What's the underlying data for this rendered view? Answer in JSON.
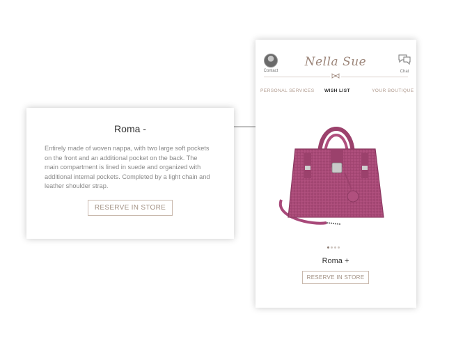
{
  "detail_card": {
    "title": "Roma -",
    "description": "Entirely made of woven nappa, with two large soft pockets on the front and an additional pocket on the back. The main compartment is lined in suede and organized with additional internal pockets. Completed by a light chain and leather shoulder strap.",
    "reserve_label": "RESERVE IN STORE"
  },
  "phone": {
    "brand": "Nella Sue",
    "contact_label": "Contact",
    "chat_label": "Chat",
    "tabs": [
      {
        "label": "PERSONAL SERVICES",
        "active": false
      },
      {
        "label": "WISH LIST",
        "active": true
      },
      {
        "label": "YOUR BOUTIQUE",
        "active": false
      }
    ],
    "carousel": {
      "pages": 4,
      "current": 1
    },
    "product_title": "Roma +",
    "reserve_label": "RESERVE IN STORE"
  },
  "colors": {
    "accent": "#9c8579",
    "bag": "#b0507e",
    "connector_dot": "#8a6b58"
  },
  "icons": [
    "avatar-icon",
    "chat-bubble-icon",
    "bow-ornament-icon"
  ]
}
